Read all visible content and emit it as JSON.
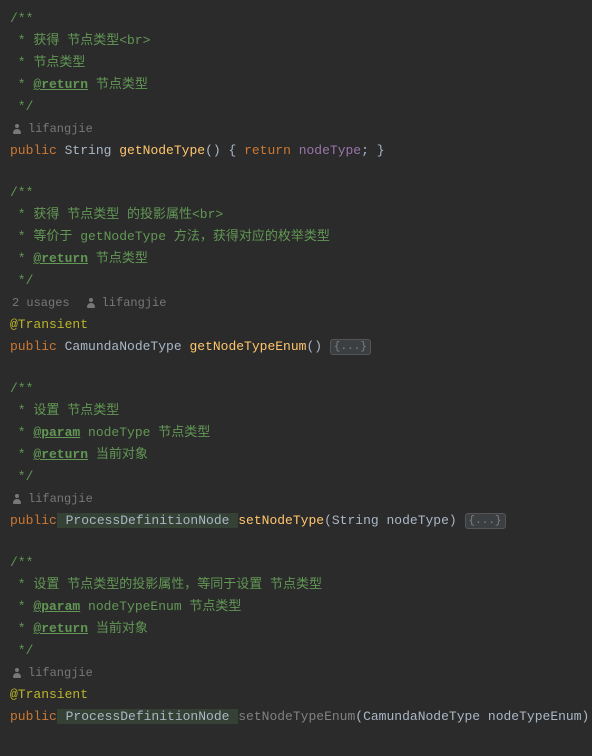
{
  "authors": {
    "a1": "lifangjie",
    "a2": "lifangjie",
    "a3": "lifangjie",
    "a4": "lifangjie"
  },
  "usages": {
    "u1": "2 usages"
  },
  "fold": "{...}",
  "block1": {
    "l1": "/**",
    "l2": " * 获得 节点类型<br>",
    "l3": " * 节点类型",
    "l4a": " * ",
    "tag": "@return",
    "l4b": " 节点类型",
    "l5": " */",
    "kw_public": "public",
    "type": " String ",
    "method": "getNodeType",
    "sig": "() ",
    "brace_open": "{ ",
    "kw_return": "return",
    "field": " nodeType",
    "semi": "; ",
    "brace_close": "}"
  },
  "block2": {
    "l1": "/**",
    "l2": " * 获得 节点类型 的投影属性<br>",
    "l3": " * 等价于 getNodeType 方法，获得对应的枚举类型",
    "l4a": " * ",
    "tag": "@return",
    "l4b": " 节点类型",
    "l5": " */",
    "anno": "@Transient",
    "kw_public": "public",
    "type": " CamundaNodeType ",
    "method": "getNodeTypeEnum",
    "sig": "() "
  },
  "block3": {
    "l1": "/**",
    "l2": " * 设置 节点类型",
    "l3a": " * ",
    "tag3": "@param",
    "l3b": " nodeType 节点类型",
    "l4a": " * ",
    "tag4": "@return",
    "l4b": " 当前对象",
    "l5": " */",
    "kw_public": "public",
    "type": " ProcessDefinitionNode ",
    "method": "setNodeType",
    "sig": "(String nodeType) "
  },
  "block4": {
    "l1": "/**",
    "l2": " * 设置 节点类型的投影属性，等同于设置 节点类型",
    "l3a": " * ",
    "tag3": "@param",
    "l3b": " nodeTypeEnum 节点类型",
    "l4a": " * ",
    "tag4": "@return",
    "l4b": " 当前对象",
    "l5": " */",
    "anno": "@Transient",
    "kw_public": "public",
    "type": " ProcessDefinitionNode ",
    "method": "setNodeTypeEnum",
    "sig": "(CamundaNodeType nodeTypeEnum) "
  }
}
